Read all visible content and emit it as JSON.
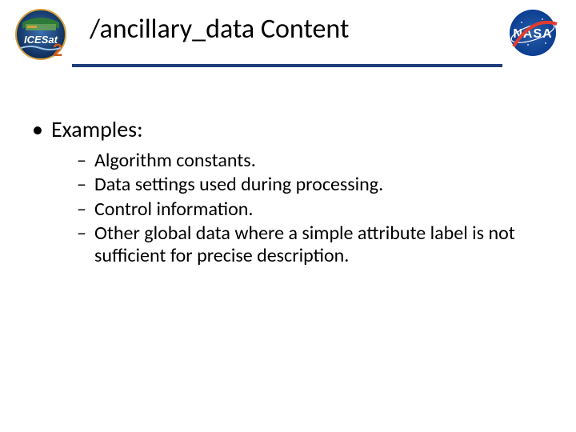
{
  "header": {
    "title": "/ancillary_data Content",
    "logo_left_alt": "ICESat-2",
    "logo_right_alt": "NASA"
  },
  "content": {
    "heading": "Examples:",
    "items": [
      "Algorithm constants.",
      "Data settings used during processing.",
      "Control information.",
      "Other global data where a simple attribute label is not sufficient for precise description."
    ]
  }
}
